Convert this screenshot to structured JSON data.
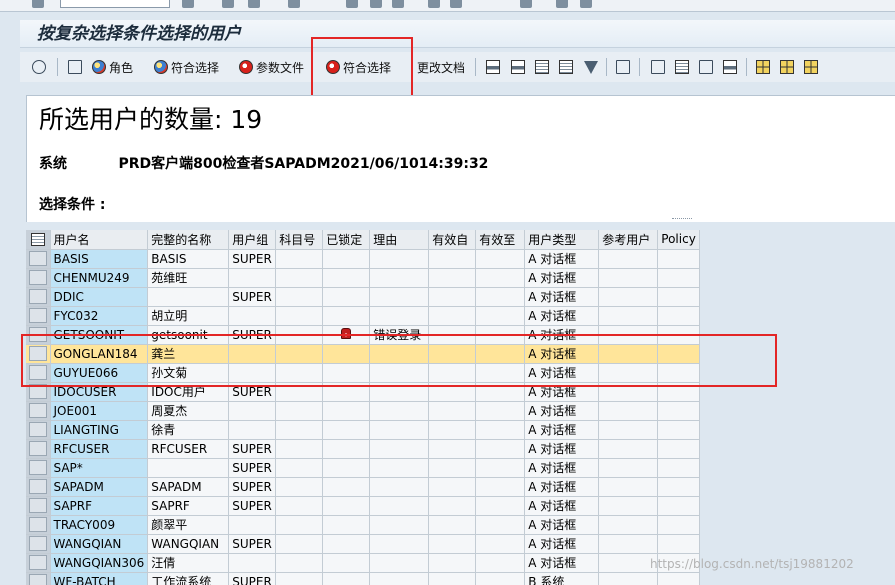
{
  "window": {
    "title": "按复杂选择条件选择的用户"
  },
  "toolbar": {
    "role_label": "角色",
    "match_select_label": "符合选择",
    "param_file_label": "参数文件",
    "match_select2_label": "符合选择",
    "change_doc_label": "更改文档"
  },
  "header": {
    "count_text": "所选用户的数量: 19",
    "system_label": "系统",
    "system_value": "PRD客户端800检查者SAPADM2021/06/1014:39:32",
    "criteria_label": "选择条件 :"
  },
  "table": {
    "columns": [
      "用户名",
      "完整的名称",
      "用户组",
      "科目号",
      "已锁定",
      "理由",
      "有效自",
      "有效至",
      "用户类型",
      "参考用户",
      "Policy"
    ],
    "rows": [
      {
        "user": "BASIS",
        "name": "BASIS",
        "group": "SUPER",
        "account": "",
        "locked": false,
        "reason": "",
        "from": "",
        "to": "",
        "type": "A 对话框",
        "ref": "",
        "policy": ""
      },
      {
        "user": "CHENMU249",
        "name": "苑维旺",
        "group": "",
        "account": "",
        "locked": false,
        "reason": "",
        "from": "",
        "to": "",
        "type": "A 对话框",
        "ref": "",
        "policy": ""
      },
      {
        "user": "DDIC",
        "name": "",
        "group": "SUPER",
        "account": "",
        "locked": false,
        "reason": "",
        "from": "",
        "to": "",
        "type": "A 对话框",
        "ref": "",
        "policy": ""
      },
      {
        "user": "FYC032",
        "name": "胡立明",
        "group": "",
        "account": "",
        "locked": false,
        "reason": "",
        "from": "",
        "to": "",
        "type": "A 对话框",
        "ref": "",
        "policy": ""
      },
      {
        "user": "GETSOONIT",
        "name": "getsoonit",
        "group": "SUPER",
        "account": "",
        "locked": true,
        "reason": "错误登录",
        "from": "",
        "to": "",
        "type": "A 对话框",
        "ref": "",
        "policy": ""
      },
      {
        "user": "GONGLAN184",
        "name": "龚兰",
        "group": "",
        "account": "",
        "locked": false,
        "reason": "",
        "from": "",
        "to": "",
        "type": "A 对话框",
        "ref": "",
        "policy": ""
      },
      {
        "user": "GUYUE066",
        "name": "孙文菊",
        "group": "",
        "account": "",
        "locked": false,
        "reason": "",
        "from": "",
        "to": "",
        "type": "A 对话框",
        "ref": "",
        "policy": ""
      },
      {
        "user": "IDOCUSER",
        "name": "IDOC用户",
        "group": "SUPER",
        "account": "",
        "locked": false,
        "reason": "",
        "from": "",
        "to": "",
        "type": "A 对话框",
        "ref": "",
        "policy": ""
      },
      {
        "user": "JOE001",
        "name": "周夏杰",
        "group": "",
        "account": "",
        "locked": false,
        "reason": "",
        "from": "",
        "to": "",
        "type": "A 对话框",
        "ref": "",
        "policy": ""
      },
      {
        "user": "LIANGTING",
        "name": "徐青",
        "group": "",
        "account": "",
        "locked": false,
        "reason": "",
        "from": "",
        "to": "",
        "type": "A 对话框",
        "ref": "",
        "policy": ""
      },
      {
        "user": "RFCUSER",
        "name": "RFCUSER",
        "group": "SUPER",
        "account": "",
        "locked": false,
        "reason": "",
        "from": "",
        "to": "",
        "type": "A 对话框",
        "ref": "",
        "policy": ""
      },
      {
        "user": "SAP*",
        "name": "",
        "group": "SUPER",
        "account": "",
        "locked": false,
        "reason": "",
        "from": "",
        "to": "",
        "type": "A 对话框",
        "ref": "",
        "policy": ""
      },
      {
        "user": "SAPADM",
        "name": "SAPADM",
        "group": "SUPER",
        "account": "",
        "locked": false,
        "reason": "",
        "from": "",
        "to": "",
        "type": "A 对话框",
        "ref": "",
        "policy": ""
      },
      {
        "user": "SAPRF",
        "name": "SAPRF",
        "group": "SUPER",
        "account": "",
        "locked": false,
        "reason": "",
        "from": "",
        "to": "",
        "type": "A 对话框",
        "ref": "",
        "policy": ""
      },
      {
        "user": "TRACY009",
        "name": "颜翠平",
        "group": "",
        "account": "",
        "locked": false,
        "reason": "",
        "from": "",
        "to": "",
        "type": "A 对话框",
        "ref": "",
        "policy": ""
      },
      {
        "user": "WANGQIAN",
        "name": "WANGQIAN",
        "group": "SUPER",
        "account": "",
        "locked": false,
        "reason": "",
        "from": "",
        "to": "",
        "type": "A 对话框",
        "ref": "",
        "policy": ""
      },
      {
        "user": "WANGQIAN306",
        "name": "汪倩",
        "group": "",
        "account": "",
        "locked": false,
        "reason": "",
        "from": "",
        "to": "",
        "type": "A 对话框",
        "ref": "",
        "policy": ""
      },
      {
        "user": "WF-BATCH",
        "name": "工作流系统",
        "group": "SUPER",
        "account": "",
        "locked": false,
        "reason": "",
        "from": "",
        "to": "",
        "type": "B 系统",
        "ref": "",
        "policy": ""
      }
    ],
    "highlighted_user": "GONGLAN184"
  },
  "watermark": "https://blog.csdn.net/tsj19881202",
  "colors": {
    "annotation_red": "#e32626",
    "selected_row": "#ffe59a",
    "key_column": "#bfe3f6",
    "lock_red": "#c11e1e"
  },
  "icons": {
    "locked_row": "lock-icon",
    "toolbar": [
      "magnify-icon",
      "details-icon",
      "roles-icon",
      "profiles-icon",
      "param-file-icon",
      "match-select-icon",
      "print-icon",
      "filter-icon",
      "layout-icon"
    ]
  }
}
